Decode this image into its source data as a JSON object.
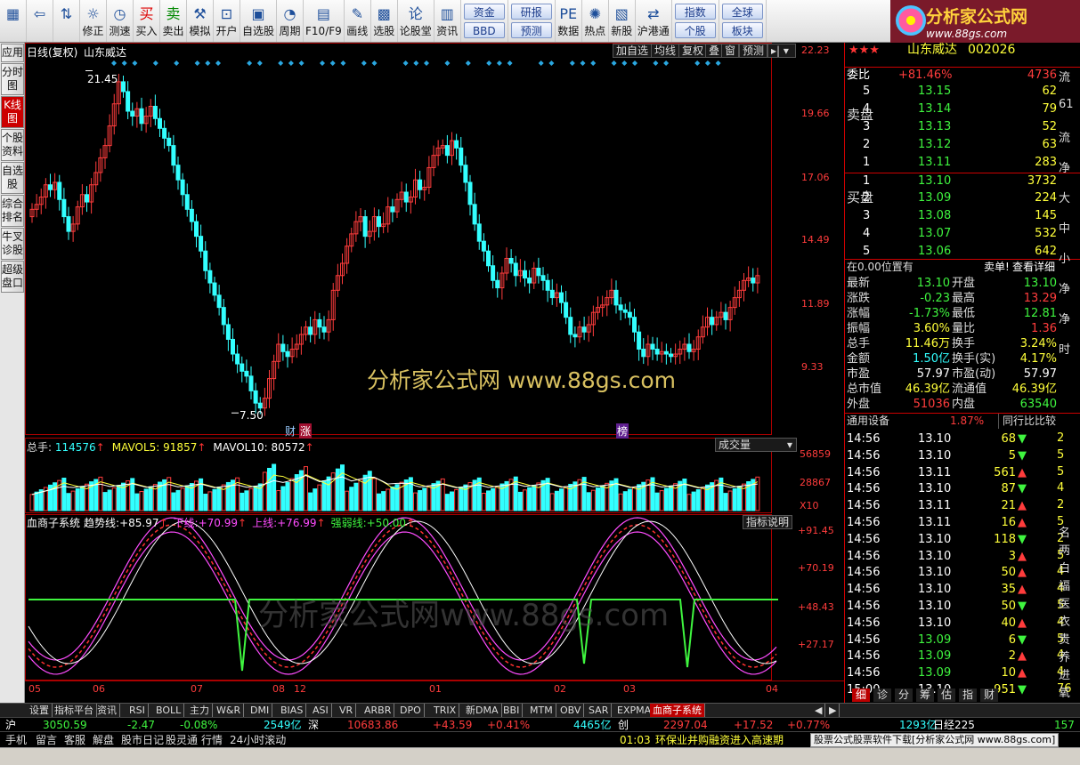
{
  "toolbar": {
    "buttons": [
      {
        "label": "",
        "icon": "home-grid-icon"
      },
      {
        "label": "",
        "icon": "back-arrow-icon"
      },
      {
        "label": "",
        "icon": "up-down-arrows-icon"
      },
      {
        "label": "修正",
        "icon": "correction-icon"
      },
      {
        "label": "测速",
        "icon": "clock-icon"
      },
      {
        "label": "买入",
        "icon": "buy-icon"
      },
      {
        "label": "卖出",
        "icon": "sell-icon"
      },
      {
        "label": "模拟",
        "icon": "hammer-icon"
      },
      {
        "label": "开户",
        "icon": "lock-icon"
      },
      {
        "label": "自选股",
        "icon": "folder-icon"
      },
      {
        "label": "周期",
        "icon": "cycle-icon"
      },
      {
        "label": "F10/F9",
        "icon": "f10-icon"
      },
      {
        "label": "画线",
        "icon": "pencil-icon"
      },
      {
        "label": "选股",
        "icon": "select-stock-icon"
      },
      {
        "label": "论股堂",
        "icon": "forum-icon"
      },
      {
        "label": "资讯",
        "icon": "news-icon"
      }
    ],
    "group1": [
      "资金",
      "BBD"
    ],
    "group2": [
      "研报",
      "预测"
    ],
    "buttons2": [
      {
        "label": "数据",
        "icon": "pe-icon"
      },
      {
        "label": "热点",
        "icon": "hot-icon"
      },
      {
        "label": "新股",
        "icon": "new-stock-icon"
      },
      {
        "label": "沪港通",
        "icon": "shhk-icon"
      }
    ],
    "group3": [
      "指数",
      "个股"
    ],
    "group4": [
      "全球",
      "板块"
    ]
  },
  "logo": {
    "title": "分析家公式网",
    "url": "www.88gs.com"
  },
  "left_tabs": [
    "应用",
    "分时图",
    "K线图",
    "个股资料",
    "自选股",
    "综合排名",
    "牛叉诊股",
    "超级盘口"
  ],
  "chart": {
    "title": "日线(复权)",
    "stock": "山东威达",
    "buttons": [
      "加自选",
      "均线",
      "复权",
      "叠",
      "窗",
      "预测"
    ],
    "high_marker": "21.45",
    "low_marker": "7.50",
    "price_ticks": [
      "22.23",
      "19.66",
      "17.06",
      "14.49",
      "11.89",
      "9.33"
    ],
    "event_labels": [
      "财",
      "涨",
      "榜"
    ],
    "watermark": "分析家公式网 www.88gs.com",
    "watermark2": "分析家公式网www.88gs.com",
    "volume": {
      "legend": [
        {
          "label": "总手:",
          "value": "114576",
          "color": "#ddd",
          "value_color": "#3ff"
        },
        {
          "label": "MAVOL5:",
          "value": "91857",
          "color": "#ffff3a",
          "value_color": "#ffff3a"
        },
        {
          "label": "MAVOL10:",
          "value": "80572",
          "color": "#fff",
          "value_color": "#fff"
        }
      ],
      "dropdown": "成交量",
      "ticks": [
        "56859",
        "28867",
        "X10"
      ]
    },
    "indicator": {
      "name": "血商子系统",
      "legend": [
        {
          "label": "趋势线:",
          "value": "+85.97",
          "color": "#fff"
        },
        {
          "label": "下线:",
          "value": "+70.99",
          "color": "#ff4cff"
        },
        {
          "label": "上线:",
          "value": "+76.99",
          "color": "#ff4cff"
        },
        {
          "label": "强弱线:",
          "value": "+50.00",
          "color": "#3ff53f"
        }
      ],
      "button": "指标说明",
      "ticks": [
        "+91.45",
        "+70.19",
        "+48.43",
        "+27.17"
      ]
    },
    "date_axis": [
      "05",
      "06",
      "07",
      "08",
      "12",
      "01",
      "02",
      "03",
      "04"
    ]
  },
  "chart_data": {
    "type": "candlestick",
    "title": "日线(复权) 山东威达",
    "ylim": [
      7.0,
      22.23
    ],
    "y_ticks": [
      22.23,
      19.66,
      17.06,
      14.49,
      11.89,
      9.33
    ],
    "annotations": {
      "high": 21.45,
      "low": 7.5
    },
    "closes": [
      15.8,
      16.0,
      16.3,
      16.8,
      16.6,
      16.9,
      16.2,
      15.5,
      14.9,
      15.2,
      15.9,
      16.4,
      16.1,
      16.8,
      17.3,
      17.9,
      18.4,
      19.2,
      20.1,
      21.0,
      20.6,
      19.8,
      19.6,
      19.9,
      19.3,
      19.6,
      20.0,
      19.5,
      19.1,
      18.7,
      18.4,
      17.6,
      17.0,
      16.4,
      15.8,
      15.3,
      14.7,
      14.1,
      13.3,
      12.8,
      12.3,
      11.8,
      11.1,
      10.5,
      9.9,
      9.5,
      9.2,
      9.0,
      8.4,
      7.9,
      7.7,
      8.1,
      8.9,
      9.6,
      10.3,
      10.0,
      9.8,
      10.1,
      10.3,
      10.7,
      11.0,
      10.7,
      11.3,
      11.0,
      10.8,
      11.3,
      12.5,
      13.1,
      13.6,
      14.3,
      14.8,
      15.3,
      15.5,
      14.7,
      14.9,
      15.5,
      15.1,
      15.2,
      15.9,
      15.7,
      16.2,
      16.5,
      16.1,
      16.3,
      17.0,
      16.6,
      16.7,
      17.5,
      18.0,
      18.3,
      18.4,
      18.0,
      18.6,
      18.3,
      17.6,
      16.9,
      16.0,
      15.2,
      14.5,
      14.1,
      13.5,
      12.9,
      12.6,
      13.2,
      13.8,
      13.6,
      13.1,
      13.3,
      13.0,
      12.8,
      13.4,
      13.1,
      12.9,
      12.5,
      12.2,
      12.4,
      12.0,
      11.4,
      10.7,
      10.6,
      11.0,
      10.8,
      11.1,
      11.6,
      11.8,
      11.9,
      12.2,
      12.5,
      11.9,
      11.7,
      11.6,
      11.4,
      10.8,
      10.1,
      9.8,
      10.3,
      10.1,
      9.9,
      10.0,
      9.9,
      9.8,
      9.9,
      10.1,
      10.3,
      10.0,
      10.1,
      10.6,
      11.0,
      11.4,
      11.1,
      11.4,
      11.6,
      11.3,
      11.8,
      12.2,
      12.5,
      12.9,
      13.0,
      12.8,
      13.1
    ]
  },
  "right_panel": {
    "stars": "★★★",
    "stock_name": "山东威达",
    "stock_code": "002026",
    "weibi": {
      "label": "委比",
      "pct": "+81.46%",
      "diff": "4736"
    },
    "sell_label": "卖盘",
    "sell": [
      {
        "n": "5",
        "price": "13.15",
        "vol": "62"
      },
      {
        "n": "4",
        "price": "13.14",
        "vol": "79"
      },
      {
        "n": "3",
        "price": "13.13",
        "vol": "52"
      },
      {
        "n": "2",
        "price": "13.12",
        "vol": "63"
      },
      {
        "n": "1",
        "price": "13.11",
        "vol": "283"
      }
    ],
    "buy_label": "买盘",
    "buy": [
      {
        "n": "1",
        "price": "13.10",
        "vol": "3732"
      },
      {
        "n": "2",
        "price": "13.09",
        "vol": "224"
      },
      {
        "n": "3",
        "price": "13.08",
        "vol": "145"
      },
      {
        "n": "4",
        "price": "13.07",
        "vol": "532"
      },
      {
        "n": "5",
        "price": "13.06",
        "vol": "642"
      }
    ],
    "position_label": "在0.00位置有",
    "sell_one_label": "卖单!",
    "detail_label": "查看详细",
    "quote": [
      {
        "l1": "最新",
        "v1": "13.10",
        "c1": "#3ff53f",
        "l2": "开盘",
        "v2": "13.10",
        "c2": "#3ff53f"
      },
      {
        "l1": "涨跌",
        "v1": "-0.23",
        "c1": "#3ff53f",
        "l2": "最高",
        "v2": "13.29",
        "c2": "#ff3c3c"
      },
      {
        "l1": "涨幅",
        "v1": "-1.73%",
        "c1": "#3ff53f",
        "l2": "最低",
        "v2": "12.81",
        "c2": "#3ff53f"
      },
      {
        "l1": "振幅",
        "v1": "3.60%",
        "c1": "#ffff3a",
        "l2": "量比",
        "v2": "1.36",
        "c2": "#ff3c3c"
      },
      {
        "l1": "总手",
        "v1": "11.46万",
        "c1": "#ffff3a",
        "l2": "换手",
        "v2": "3.24%",
        "c2": "#ffff3a"
      },
      {
        "l1": "金额",
        "v1": "1.50亿",
        "c1": "#3ff",
        "l2": "换手(实)",
        "v2": "4.17%",
        "c2": "#ffff3a"
      },
      {
        "l1": "市盈",
        "v1": "57.97",
        "c1": "#fff",
        "l2": "市盈(动)",
        "v2": "57.97",
        "c2": "#fff"
      },
      {
        "l1": "总市值",
        "v1": "46.39亿",
        "c1": "#ffff3a",
        "l2": "流通值",
        "v2": "46.39亿",
        "c2": "#ffff3a"
      },
      {
        "l1": "外盘",
        "v1": "51036",
        "c1": "#ff3c3c",
        "l2": "内盘",
        "v2": "63540",
        "c2": "#3ff53f"
      }
    ],
    "industry": {
      "label": "通用设备",
      "pct": "1.87%",
      "compare": "同行比比较"
    },
    "ticks": [
      {
        "t": "14:56",
        "p": "13.10",
        "pc": "#fff",
        "v": "68",
        "d": "down"
      },
      {
        "t": "14:56",
        "p": "13.10",
        "pc": "#fff",
        "v": "5",
        "d": "down"
      },
      {
        "t": "14:56",
        "p": "13.11",
        "pc": "#fff",
        "v": "561",
        "d": "up"
      },
      {
        "t": "14:56",
        "p": "13.10",
        "pc": "#fff",
        "v": "87",
        "d": "down"
      },
      {
        "t": "14:56",
        "p": "13.11",
        "pc": "#fff",
        "v": "21",
        "d": "up"
      },
      {
        "t": "14:56",
        "p": "13.11",
        "pc": "#fff",
        "v": "16",
        "d": "up"
      },
      {
        "t": "14:56",
        "p": "13.10",
        "pc": "#fff",
        "v": "118",
        "d": "down"
      },
      {
        "t": "14:56",
        "p": "13.10",
        "pc": "#fff",
        "v": "3",
        "d": "up"
      },
      {
        "t": "14:56",
        "p": "13.10",
        "pc": "#fff",
        "v": "50",
        "d": "up"
      },
      {
        "t": "14:56",
        "p": "13.10",
        "pc": "#fff",
        "v": "35",
        "d": "up"
      },
      {
        "t": "14:56",
        "p": "13.10",
        "pc": "#fff",
        "v": "50",
        "d": "down"
      },
      {
        "t": "14:56",
        "p": "13.10",
        "pc": "#fff",
        "v": "40",
        "d": "up"
      },
      {
        "t": "14:56",
        "p": "13.09",
        "pc": "#3ff53f",
        "v": "6",
        "d": "down"
      },
      {
        "t": "14:56",
        "p": "13.09",
        "pc": "#3ff53f",
        "v": "2",
        "d": "up"
      },
      {
        "t": "14:56",
        "p": "13.09",
        "pc": "#3ff53f",
        "v": "10",
        "d": "up"
      },
      {
        "t": "15:00",
        "p": "13.10",
        "pc": "#fff",
        "v": "951",
        "d": "down"
      }
    ],
    "right_edge": [
      "2",
      "5",
      "5",
      "4",
      "2",
      "5",
      "2",
      "5",
      "4",
      "4",
      "5",
      "4",
      "5",
      "4",
      "4",
      "76"
    ],
    "right_edge_chars": [
      "流",
      "61",
      "流",
      "净",
      "大",
      "中",
      "小",
      "净",
      "净",
      "时",
      "名",
      "两",
      "白",
      "福",
      "医",
      "衣",
      "贵",
      "养",
      "进",
      "氧"
    ],
    "tabs": [
      "细",
      "诊",
      "分",
      "筹",
      "估",
      "指",
      "财"
    ]
  },
  "bottom_tabs": [
    "设置",
    "指标平台",
    "资讯",
    "RSI",
    "BOLL",
    "主力",
    "W&R",
    "DMI",
    "BIAS",
    "ASI",
    "VR",
    "ARBR",
    "DPO",
    "TRIX",
    "新DMA",
    "BBI",
    "MTM",
    "OBV",
    "SAR",
    "EXPMA",
    "血商子系统"
  ],
  "index_bar": {
    "sh_label": "沪",
    "sh_val": "3050.59",
    "sh_chg": "-2.47",
    "sh_pct": "-0.08%",
    "sh_amt": "2549亿",
    "sz_label": "深",
    "sz_val": "10683.86",
    "sz_chg": "+43.59",
    "sz_pct": "+0.41%",
    "sz_amt": "4465亿",
    "cy_label": "创",
    "cy_val": "2297.04",
    "cy_chg": "+17.52",
    "cy_pct": "+0.77%",
    "amt2": "1293亿",
    "extra": "日经225",
    "extra_val": "157"
  },
  "status_bar": {
    "items": [
      "手机",
      "留言",
      "客服",
      "解盘",
      "股市日记",
      "股灵通",
      "行情",
      "24小时滚动"
    ],
    "time": "01:03",
    "news": "环保业并购融资进入高速期",
    "ad": "股票公式股票软件下载[分析家公式网 www.88gs.com]"
  }
}
